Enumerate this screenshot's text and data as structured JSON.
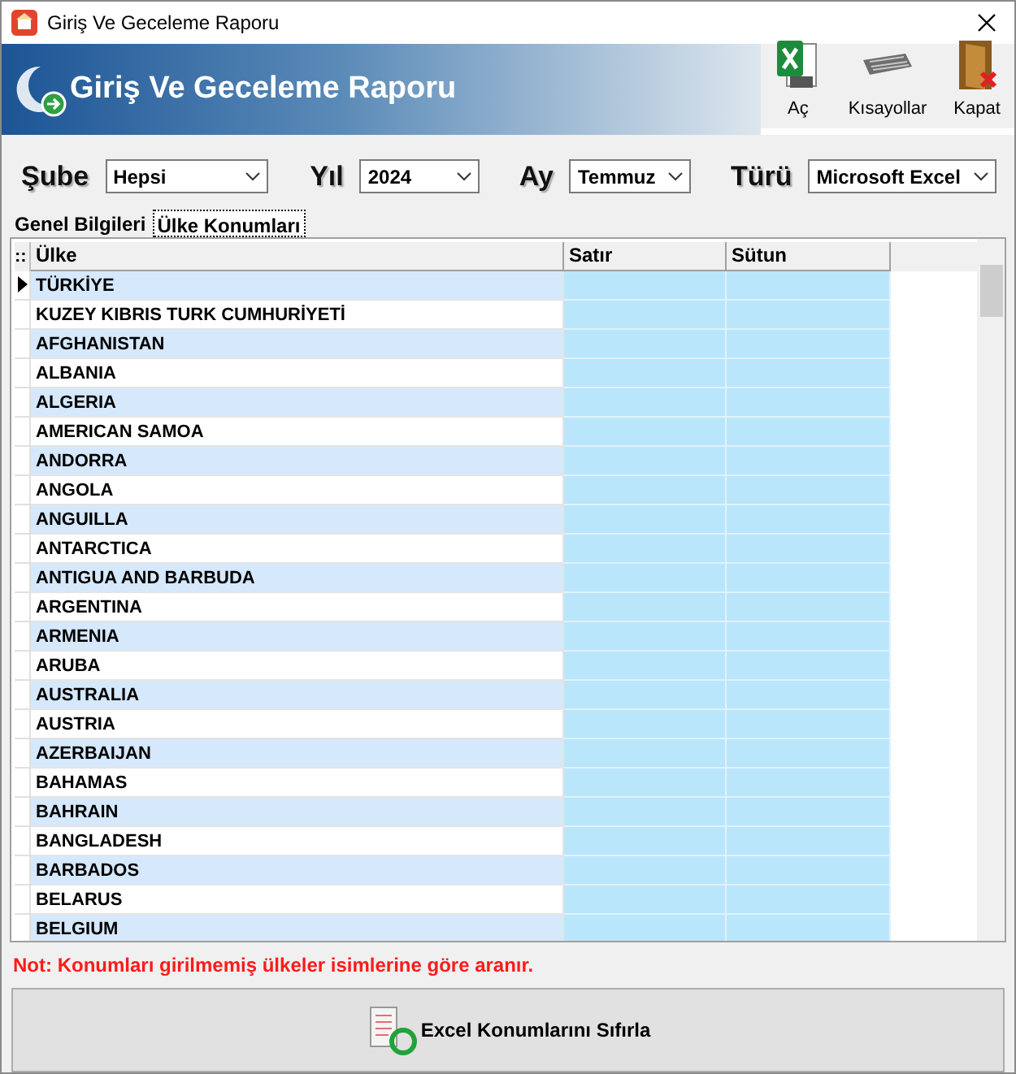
{
  "window": {
    "title": "Giriş Ve Geceleme Raporu"
  },
  "header": {
    "title": "Giriş Ve Geceleme Raporu"
  },
  "toolbar": [
    {
      "kind": "excel",
      "label": "Aç"
    },
    {
      "kind": "keyboard",
      "label": "Kısayollar"
    },
    {
      "kind": "door",
      "label": "Kapat"
    }
  ],
  "filters": [
    {
      "label": "Şube",
      "value": "Hepsi"
    },
    {
      "label": "Yıl",
      "value": "2024"
    },
    {
      "label": "Ay",
      "value": "Temmuz"
    },
    {
      "label": "Türü",
      "value": "Microsoft Excel"
    }
  ],
  "tabs": [
    {
      "label": "Genel Bilgileri",
      "selected": false
    },
    {
      "label": "Ülke Konumları",
      "selected": true
    }
  ],
  "grid": {
    "indicator": "::",
    "columns": [
      "Ülke",
      "Satır",
      "Sütun"
    ],
    "rows": [
      {
        "country": "TÜRKİYE",
        "selected": true
      },
      {
        "country": "KUZEY KIBRIS TURK CUMHURİYETİ",
        "selected": false
      },
      {
        "country": "AFGHANISTAN",
        "selected": false
      },
      {
        "country": "ALBANIA",
        "selected": false
      },
      {
        "country": "ALGERIA",
        "selected": false
      },
      {
        "country": "AMERICAN SAMOA",
        "selected": false
      },
      {
        "country": "ANDORRA",
        "selected": false
      },
      {
        "country": "ANGOLA",
        "selected": false
      },
      {
        "country": "ANGUILLA",
        "selected": false
      },
      {
        "country": "ANTARCTICA",
        "selected": false
      },
      {
        "country": "ANTIGUA AND BARBUDA",
        "selected": false
      },
      {
        "country": "ARGENTINA",
        "selected": false
      },
      {
        "country": "ARMENIA",
        "selected": false
      },
      {
        "country": "ARUBA",
        "selected": false
      },
      {
        "country": "AUSTRALIA",
        "selected": false
      },
      {
        "country": "AUSTRIA",
        "selected": false
      },
      {
        "country": "AZERBAIJAN",
        "selected": false
      },
      {
        "country": "BAHAMAS",
        "selected": false
      },
      {
        "country": "BAHRAIN",
        "selected": false
      },
      {
        "country": "BANGLADESH",
        "selected": false
      },
      {
        "country": "BARBADOS",
        "selected": false
      },
      {
        "country": "BELARUS",
        "selected": false
      },
      {
        "country": "BELGIUM",
        "selected": false
      }
    ]
  },
  "note": "Not: Konumları girilmemiş ülkeler isimlerine göre aranır.",
  "reset_button": {
    "label": "Excel Konumlarını Sıfırla"
  }
}
